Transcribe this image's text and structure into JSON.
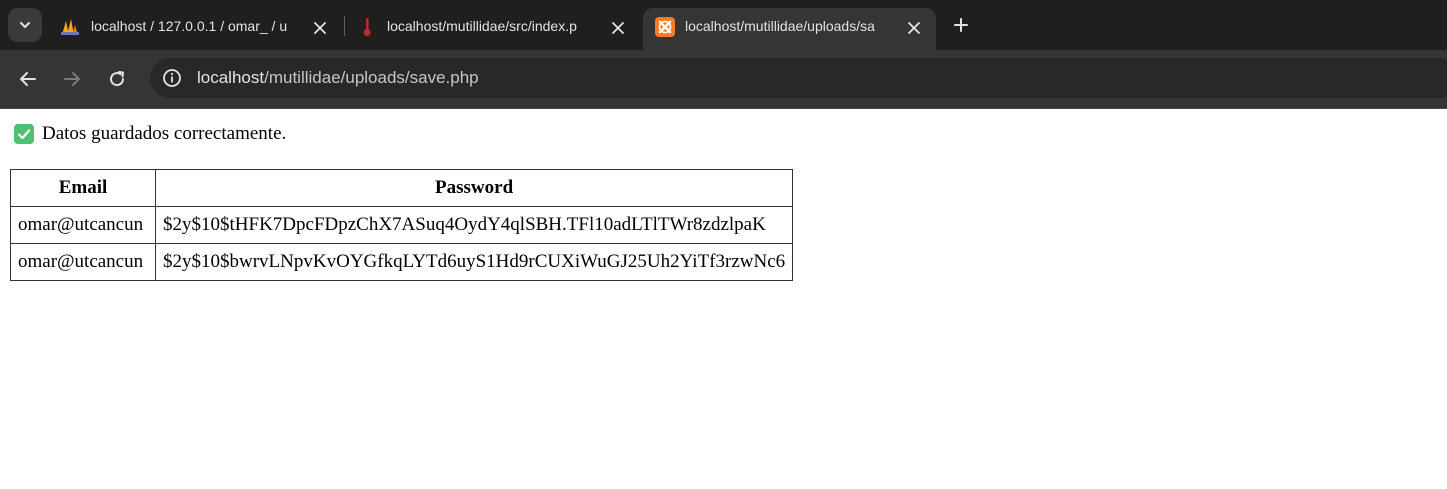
{
  "browser": {
    "tabs": [
      {
        "title": "localhost / 127.0.0.1 / omar_ / u",
        "favicon": "phpmyadmin-icon",
        "active": false
      },
      {
        "title": "localhost/mutillidae/src/index.p",
        "favicon": "mutillidae-icon",
        "active": false
      },
      {
        "title": "localhost/mutillidae/uploads/sa",
        "favicon": "xampp-icon",
        "active": true
      }
    ],
    "address": {
      "host": "localhost",
      "path": "/mutillidae/uploads/save.php"
    }
  },
  "page": {
    "message": "Datos guardados correctamente.",
    "message_icon": "check-mark-icon",
    "table": {
      "headers": [
        "Email",
        "Password"
      ],
      "rows": [
        [
          "omar@utcancun",
          "$2y$10$tHFK7DpcFDpzChX7ASuq4OydY4qlSBH.TFl10adLTlTWr8zdzlpaK"
        ],
        [
          "omar@utcancun",
          "$2y$10$bwrvLNpvKvOYGfkqLYTd6uyS1Hd9rCUXiWuGJ25Uh2YiTf3rzwNc6"
        ]
      ]
    }
  },
  "colors": {
    "tabstrip_bg": "#1f1f1f",
    "toolbar_bg": "#353535",
    "omnibox_bg": "#282828",
    "success_check": "#4fc06f",
    "xampp_orange": "#fb7a24"
  }
}
